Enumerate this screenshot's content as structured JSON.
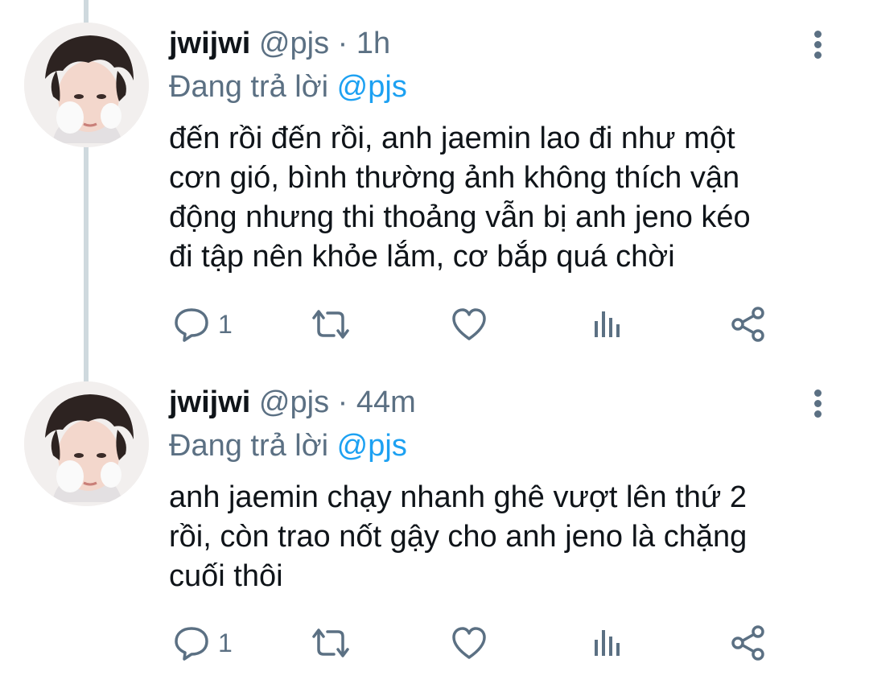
{
  "tweets": [
    {
      "name": "jwijwi",
      "handle": "@pjs",
      "separator": "·",
      "time": "1h",
      "reply_prefix": "Đang trả lời",
      "reply_to": "@pjs",
      "text": "đến rồi đến rồi, anh jaemin lao đi như một\ncơn gió, bình thường ảnh không thích vận\nđộng nhưng thi thoảng vẫn bị anh jeno kéo\nđi tập nên khỏe lắm, cơ bắp quá chời",
      "reply_count": "1"
    },
    {
      "name": "jwijwi",
      "handle": "@pjs",
      "separator": "·",
      "time": "44m",
      "reply_prefix": "Đang trả lời",
      "reply_to": "@pjs",
      "text": "anh jaemin chạy nhanh ghê vượt lên thứ 2\nrồi, còn trao nốt gậy cho anh jeno là chặng\ncuối thôi",
      "reply_count": "1"
    }
  ],
  "icons": {
    "more": "vertical-ellipsis",
    "reply": "speech-bubble",
    "retweet": "retweet-arrows",
    "like": "heart-outline",
    "analytics": "bar-chart",
    "share": "share-nodes"
  },
  "colors": {
    "text": "#0f1419",
    "secondary": "#5b7083",
    "mention": "#1da1f2",
    "thread_line": "#cfd9de"
  }
}
